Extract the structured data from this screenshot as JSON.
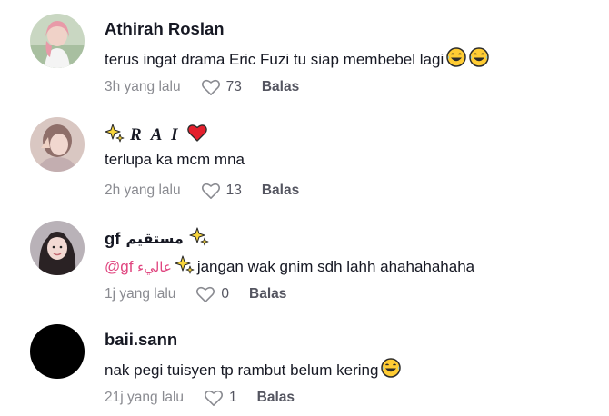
{
  "comments": [
    {
      "username": "Athirah Roslan",
      "text": "terus ingat drama Eric Fuzi tu siap membebel lagi",
      "emojis": [
        "laughing-tears",
        "laughing-tears"
      ],
      "time": "3h yang lalu",
      "likes": "73",
      "reply_label": "Balas"
    },
    {
      "username": "R A I",
      "username_emojis": [
        "sparkles",
        "red-heart"
      ],
      "text": "terlupa ka mcm mna",
      "time": "2h yang lalu",
      "likes": "13",
      "reply_label": "Balas"
    },
    {
      "username": "gf",
      "username_arabic": "مستقيم",
      "username_emojis": [
        "sparkles"
      ],
      "mention_prefix": "@gf",
      "mention_arabic": "عاليء",
      "text": "jangan wak gnim sdh lahh ahahahahaha",
      "time": "1j yang lalu",
      "likes": "0",
      "reply_label": "Balas"
    },
    {
      "username": "baii.sann",
      "text": "nak pegi tuisyen tp rambut belum kering",
      "emojis": [
        "laughing-tears"
      ],
      "time": "21j yang lalu",
      "likes": "1",
      "reply_label": "Balas"
    }
  ]
}
